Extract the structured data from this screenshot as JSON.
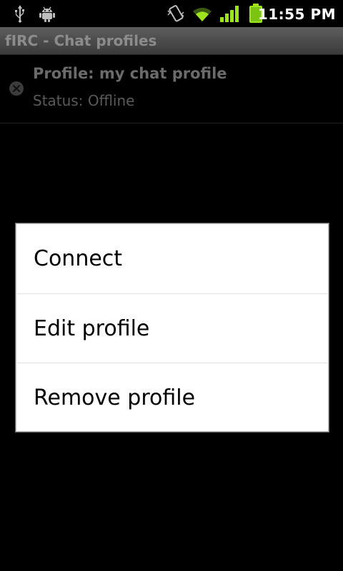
{
  "status_bar": {
    "time": "11:55 PM",
    "icons": [
      "usb-icon",
      "debug-icon",
      "vibrate-icon",
      "wifi-icon",
      "signal-icon",
      "battery-icon"
    ]
  },
  "app": {
    "title": "fIRC - Chat profiles"
  },
  "profiles": [
    {
      "name": "Profile: my chat profile",
      "status": "Status: Offline",
      "status_icon": "offline-icon"
    }
  ],
  "context_menu": {
    "items": [
      {
        "label": "Connect"
      },
      {
        "label": "Edit profile"
      },
      {
        "label": "Remove profile"
      }
    ]
  },
  "colors": {
    "battery": "#9ee51c",
    "signal": "#9ee51c",
    "wifi": "#9ee51c",
    "dialog_background": "#ffffff"
  }
}
